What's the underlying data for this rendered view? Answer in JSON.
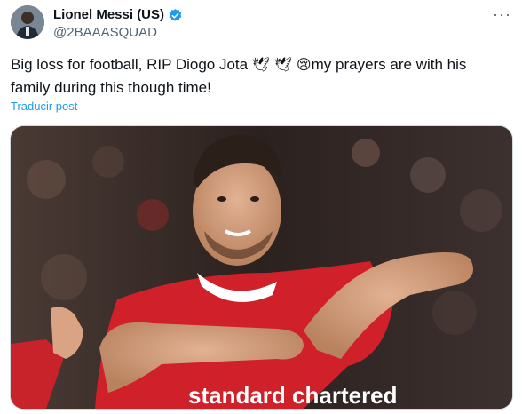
{
  "post": {
    "author": {
      "display_name": "Lionel Messi (US)",
      "handle": "@2BAAASQUAD",
      "verified": true
    },
    "more_icon": "more-horizontal-icon",
    "text_part1": "Big loss for football, RIP Diogo Jota ",
    "emoji_1": "🕊",
    "emoji_2": "🕊",
    "emoji_3": "😢",
    "text_part2": "my prayers are with his family during this though time!",
    "translate_label": "Traducir post",
    "photo": {
      "jersey_sponsor": "standard chartered"
    }
  },
  "colors": {
    "link": "#1d9bf0",
    "verified_badge": "#1d9bf0",
    "secondary_text": "#536471",
    "jersey_red": "#d0202a"
  }
}
